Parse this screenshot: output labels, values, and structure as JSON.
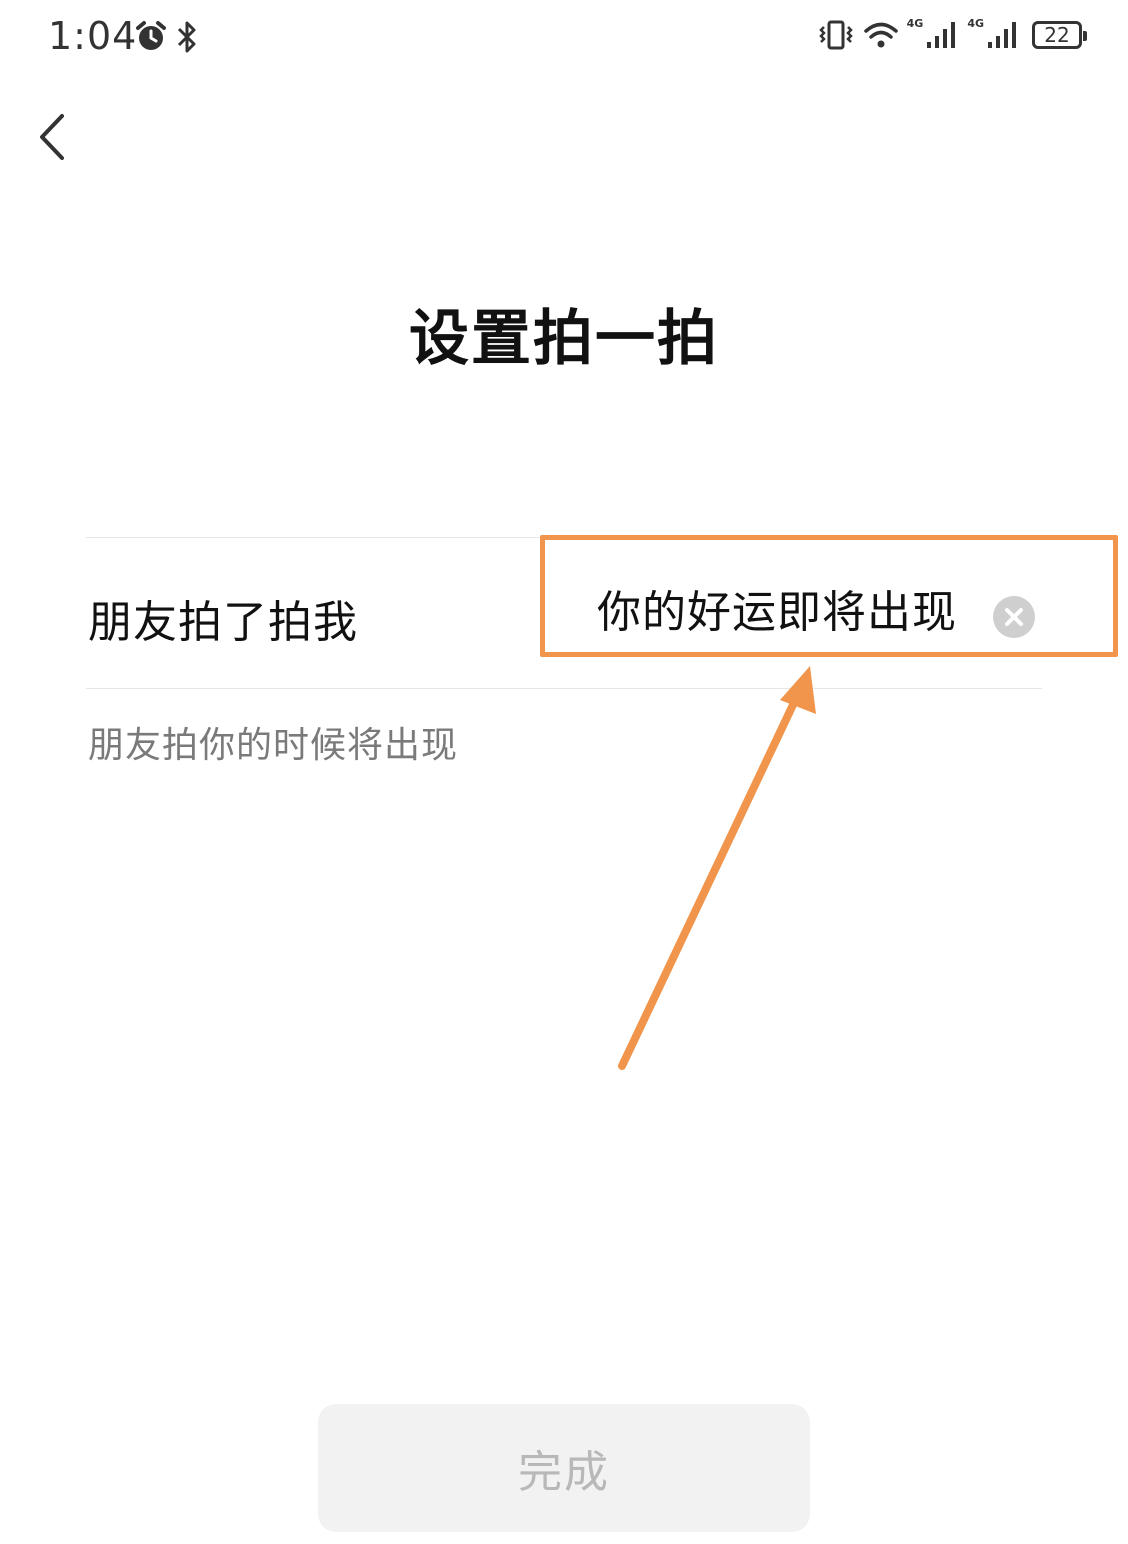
{
  "status_bar": {
    "time": "1:04",
    "network_1": "4G",
    "network_2": "4G",
    "battery": "22",
    "icons": [
      "alarm-icon",
      "bluetooth-icon",
      "vibrate-icon",
      "wifi-icon",
      "signal-icon",
      "signal-icon",
      "battery-icon"
    ]
  },
  "header": {
    "back_icon": "chevron-left-icon"
  },
  "page": {
    "title": "设置拍一拍"
  },
  "pat_setting": {
    "label": "朋友拍了拍我",
    "value": "你的好运即将出现",
    "hint": "朋友拍你的时候将出现"
  },
  "footer": {
    "done_label": "完成"
  },
  "colors": {
    "annotation": "#f0954b",
    "button_bg": "#f2f2f2",
    "button_text": "#b8b8b8"
  }
}
